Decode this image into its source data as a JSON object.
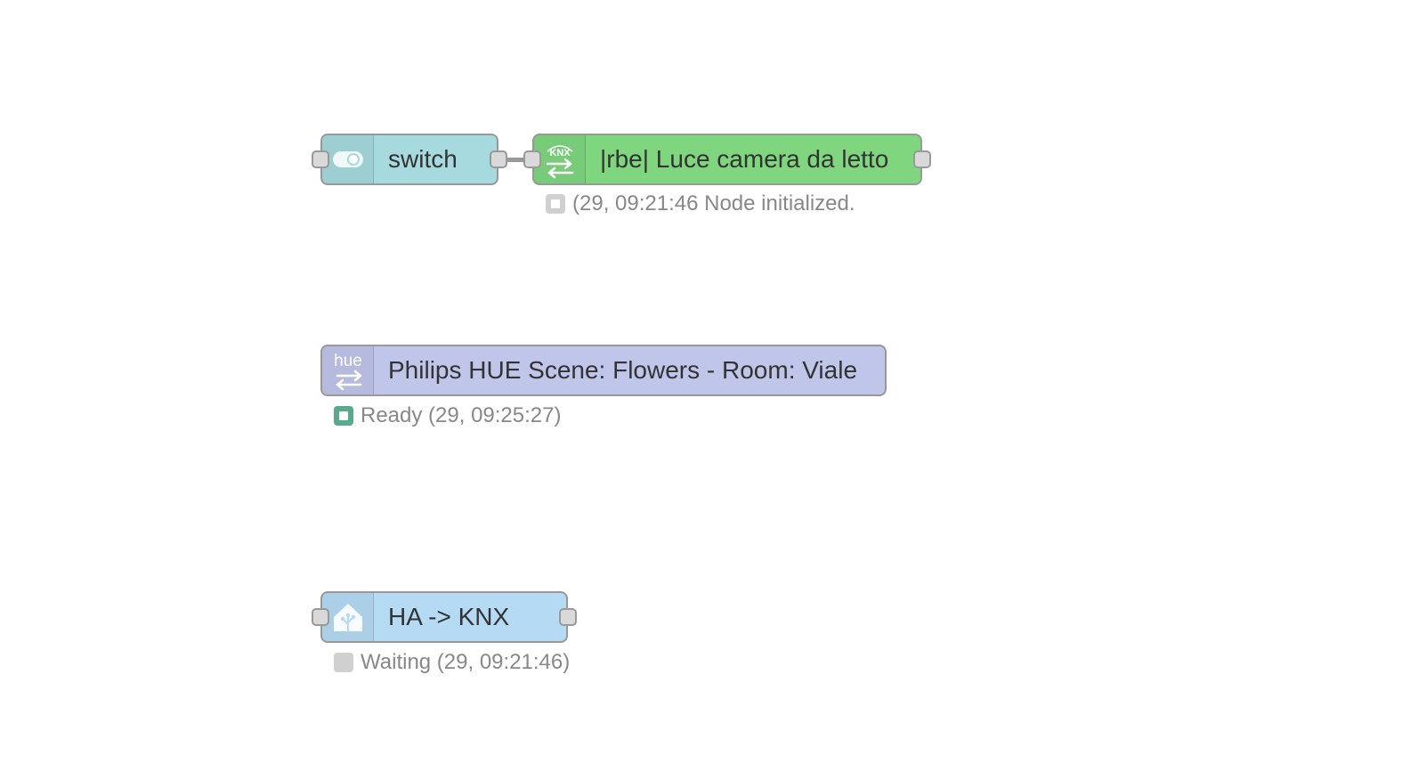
{
  "nodes": {
    "switch": {
      "label": "switch",
      "color": "#a6dade",
      "icon": "toggle-switch-icon"
    },
    "knx_device": {
      "label": "|rbe| Luce camera da letto",
      "color": "#7fd67f",
      "icon": "knx-exchange-icon",
      "icon_text": "KNX"
    },
    "hue_scene": {
      "label": "Philips HUE Scene: Flowers - Room: Viale",
      "color": "#c0c5ea",
      "icon": "hue-exchange-icon",
      "icon_text": "hue"
    },
    "ha_knx": {
      "label": "HA -> KNX",
      "color": "#b5dbf4",
      "icon": "home-assistant-icon"
    }
  },
  "statuses": {
    "knx_device": {
      "text": "(29, 09:21:46 Node initialized.",
      "color": "#d0d0d0",
      "shape": "ring"
    },
    "hue_scene": {
      "text": "Ready (29, 09:25:27)",
      "color": "#5aa98b",
      "shape": "ring"
    },
    "ha_knx": {
      "text": "Waiting (29, 09:21:46)",
      "color": "#d0d0d0",
      "shape": "dot"
    }
  }
}
